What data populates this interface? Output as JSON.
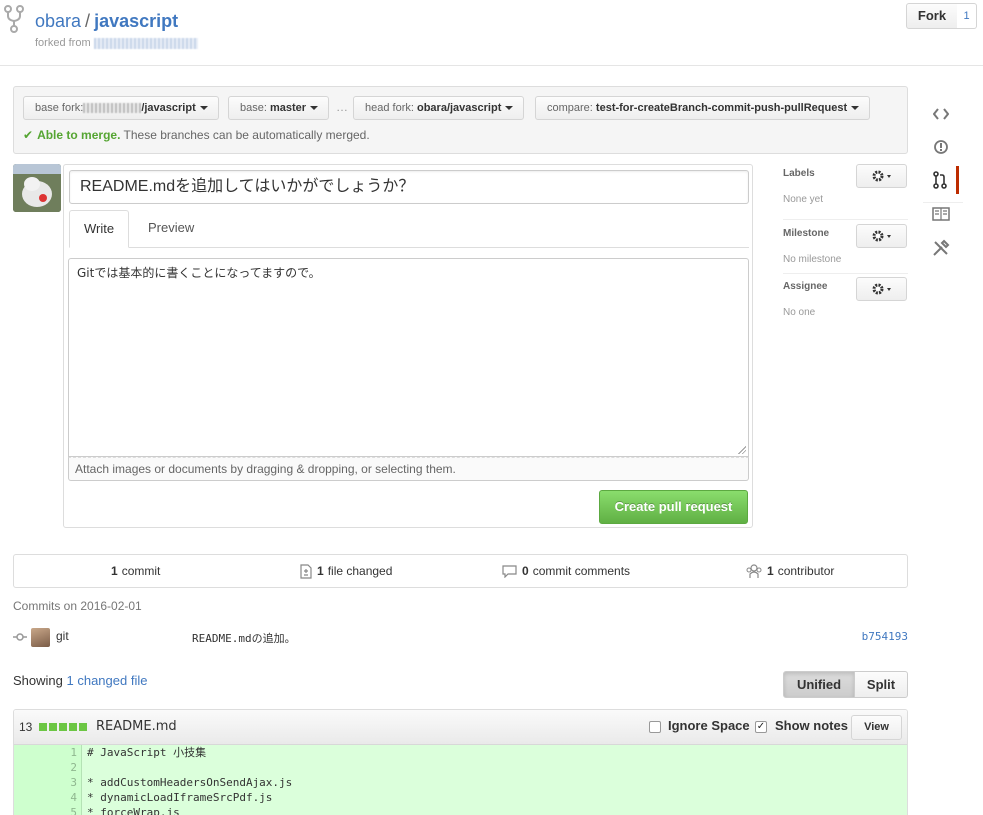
{
  "repo": {
    "owner": "obara",
    "separator": "/",
    "name": "javascript",
    "forked_from_label": "forked from"
  },
  "fork": {
    "label": "Fork",
    "count": "1"
  },
  "range": {
    "base_fork_label": "base fork:",
    "base_fork_value": "/javascript",
    "base_label": "base:",
    "base_value": "master",
    "dots": "…",
    "head_fork_label": "head fork:",
    "head_fork_value": "obara/javascript",
    "compare_label": "compare:",
    "compare_value": "test-for-createBranch-commit-push-pullRequest",
    "merge_ok": "Able to merge.",
    "merge_text": "These branches can be automatically merged."
  },
  "form": {
    "title_value": "README.mdを追加してはいかがでしょうか？",
    "tab_write": "Write",
    "tab_preview": "Preview",
    "body_value": "Gitでは基本的に書くことになってますので。",
    "attach_text": "Attach images or documents by dragging & dropping, or selecting them.",
    "submit_label": "Create pull request"
  },
  "sidebar": {
    "labels_title": "Labels",
    "labels_value": "None yet",
    "milestone_title": "Milestone",
    "milestone_value": "No milestone",
    "assignee_title": "Assignee",
    "assignee_value": "No one"
  },
  "stats": {
    "commits_count": "1",
    "commits_label": "commit",
    "files_count": "1",
    "files_label": "file changed",
    "comments_count": "0",
    "comments_label": "commit comments",
    "contributors_count": "1",
    "contributors_label": "contributor"
  },
  "commits": {
    "date_heading": "Commits on 2016-02-01",
    "items": [
      {
        "author": "git",
        "message": "README.mdの追加。",
        "sha": "b754193"
      }
    ]
  },
  "files": {
    "showing_prefix": "Showing",
    "showing_link": "1 changed file",
    "unified_label": "Unified",
    "split_label": "Split"
  },
  "file": {
    "additions": "13",
    "name": "README.md",
    "ignore_space_label": "Ignore Space",
    "show_notes_label": "Show notes",
    "view_label": "View",
    "lines": [
      {
        "num": "1",
        "text": "# JavaScript 小技集"
      },
      {
        "num": "2",
        "text": ""
      },
      {
        "num": "3",
        "text": "* addCustomHeadersOnSendAjax.js"
      },
      {
        "num": "4",
        "text": "* dynamicLoadIframeSrcPdf.js"
      },
      {
        "num": "5",
        "text": "* forceWrap.js"
      }
    ]
  },
  "colors": {
    "link": "#4078c0",
    "success": "#55a532",
    "create_button": "#60b044",
    "diff_add_bg": "#dbffdb",
    "active_nav": "#bd2c00"
  },
  "icons": {
    "repo_fork": "repo-forked-icon",
    "code": "code-icon",
    "issues": "issue-opened-icon",
    "pull_requests": "git-pull-request-icon",
    "wiki": "book-icon",
    "settings": "tools-icon",
    "gear": "gear-icon",
    "commit": "git-commit-icon",
    "file_diff": "file-diff-icon",
    "comment": "comment-icon",
    "contributors": "organization-icon"
  }
}
